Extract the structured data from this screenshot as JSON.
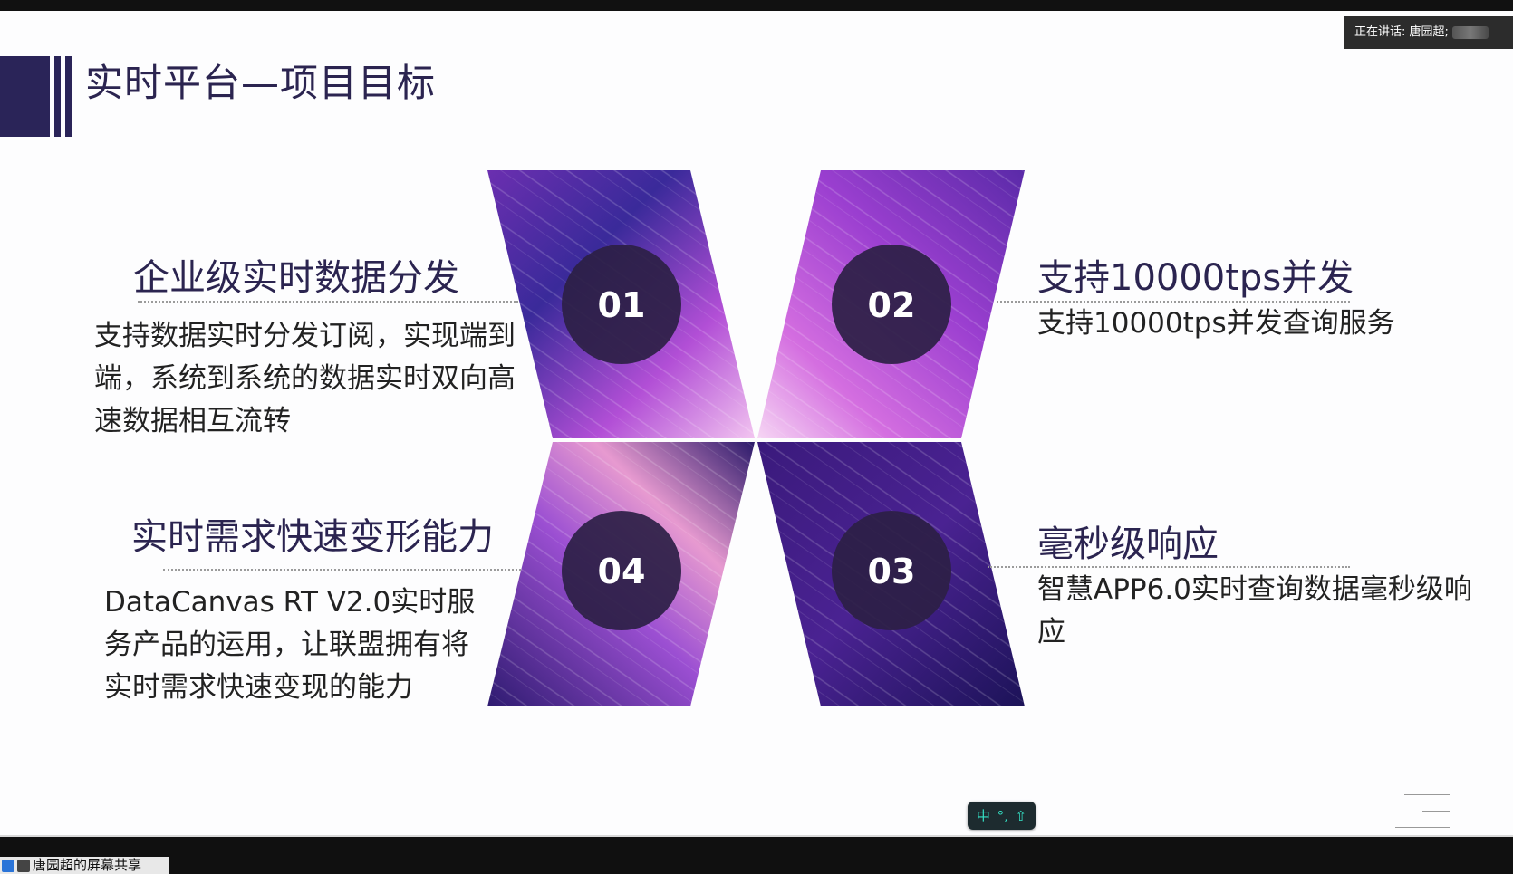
{
  "slide": {
    "title": "实时平台—项目目标"
  },
  "speaker": {
    "label": "正在讲话: 唐园超;"
  },
  "items": [
    {
      "number": "01",
      "heading": "企业级实时数据分发",
      "lines": [
        "支持数据实时分发订阅，实现端到",
        "端，系统到系统的数据实时双向高",
        "速数据相互流转"
      ]
    },
    {
      "number": "02",
      "heading": "支持10000tps并发",
      "lines": [
        "支持10000tps并发查询服务"
      ]
    },
    {
      "number": "03",
      "heading": "毫秒级响应",
      "lines": [
        "智慧APP6.0实时查询数据毫秒级响",
        "应"
      ]
    },
    {
      "number": "04",
      "heading": "实时需求快速变形能力",
      "lines": [
        "DataCanvas RT V2.0实时服",
        "务产品的运用，让联盟拥有将",
        "实时需求快速变现的能力"
      ]
    }
  ],
  "ime": {
    "mode": "中",
    "punct": "°,",
    "shift": "⇧"
  },
  "share": {
    "label": "唐园超的屏幕共享"
  },
  "colors": {
    "title": "#2b2450",
    "accent_dark": "#2a2458",
    "circle": "#2d1f45"
  }
}
